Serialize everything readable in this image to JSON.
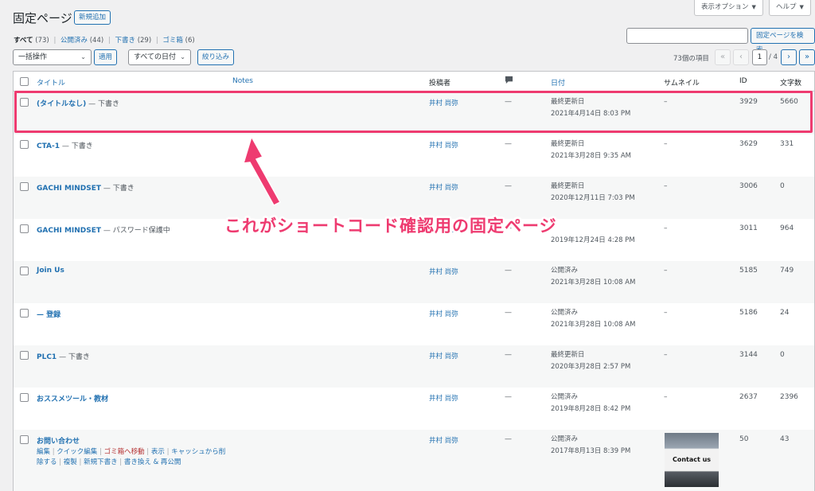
{
  "header": {
    "title": "固定ページ",
    "add_new": "新規追加",
    "screen_options": "表示オプション",
    "help": "ヘルプ"
  },
  "filters": [
    {
      "label": "すべて",
      "count": "(73)",
      "current": true
    },
    {
      "label": "公開済み",
      "count": "(44)"
    },
    {
      "label": "下書き",
      "count": "(29)"
    },
    {
      "label": "ゴミ箱",
      "count": "(6)"
    }
  ],
  "search": {
    "value": "",
    "button": "固定ページを検索"
  },
  "tablenav": {
    "bulk_action": "一括操作",
    "apply": "適用",
    "date_filter": "すべての日付",
    "filter_button": "絞り込み",
    "items_count": "73個の項目",
    "first": "«",
    "prev": "‹",
    "current_page": "1",
    "of_pages": "/ 4",
    "next": "›",
    "last": "»"
  },
  "columns": {
    "title": "タイトル",
    "notes": "Notes",
    "author": "投稿者",
    "comments_icon": "comment-bubble",
    "date": "日付",
    "thumbnail": "サムネイル",
    "id": "ID",
    "word_count": "文字数"
  },
  "rows": [
    {
      "title": "(タイトルなし)",
      "state": " — 下書き",
      "author": "井村 尚弥",
      "comments": "—",
      "date_status": "最終更新日",
      "date": "2021年4月14日 8:03 PM",
      "thumbnail": "–",
      "id": "3929",
      "words": "5660"
    },
    {
      "title": "CTA-1",
      "state": " — 下書き",
      "author": "井村 尚弥",
      "comments": "—",
      "date_status": "最終更新日",
      "date": "2021年3月28日 9:35 AM",
      "thumbnail": "–",
      "id": "3629",
      "words": "331"
    },
    {
      "title": "GACHI MINDSET",
      "state": " — 下書き",
      "author": "井村 尚弥",
      "comments": "—",
      "date_status": "最終更新日",
      "date": "2020年12月11日 7:03 PM",
      "thumbnail": "–",
      "id": "3006",
      "words": "0"
    },
    {
      "title": "GACHI MINDSET",
      "state": " — パスワード保護中",
      "author": "井村 尚弥",
      "comments": "—",
      "date_status": "",
      "date": "2019年12月24日 4:28 PM",
      "thumbnail": "–",
      "id": "3011",
      "words": "964"
    },
    {
      "title": "Join Us",
      "state": "",
      "author": "井村 尚弥",
      "comments": "—",
      "date_status": "公開済み",
      "date": "2021年3月28日 10:08 AM",
      "thumbnail": "–",
      "id": "5185",
      "words": "749"
    },
    {
      "title": "— 登録",
      "state": "",
      "author": "井村 尚弥",
      "comments": "—",
      "date_status": "公開済み",
      "date": "2021年3月28日 10:08 AM",
      "thumbnail": "–",
      "id": "5186",
      "words": "24"
    },
    {
      "title": "PLC1",
      "state": " — 下書き",
      "author": "井村 尚弥",
      "comments": "—",
      "date_status": "最終更新日",
      "date": "2020年3月28日 2:57 PM",
      "thumbnail": "–",
      "id": "3144",
      "words": "0"
    },
    {
      "title": "おススメツール・教材",
      "state": "",
      "author": "井村 尚弥",
      "comments": "—",
      "date_status": "公開済み",
      "date": "2019年8月28日 8:42 PM",
      "thumbnail": "–",
      "id": "2637",
      "words": "2396"
    },
    {
      "title": "お問い合わせ",
      "state": "",
      "author": "井村 尚弥",
      "comments": "—",
      "date_status": "公開済み",
      "date": "2017年8月13日 8:39 PM",
      "thumbnail": "Contact us",
      "id": "50",
      "words": "43"
    }
  ],
  "row_actions": {
    "edit": "編集",
    "quick_edit": "クイック編集",
    "trash": "ゴミ箱へ移動",
    "view": "表示",
    "cache_1": "キャッシュから削",
    "cache_2": "除する",
    "duplicate": "複製",
    "new_draft": "新規下書き",
    "rewrite": "書き換え & 再公開"
  },
  "annotation": {
    "text": "これがショートコード確認用の固定ページ",
    "color": "#ee3b70"
  }
}
